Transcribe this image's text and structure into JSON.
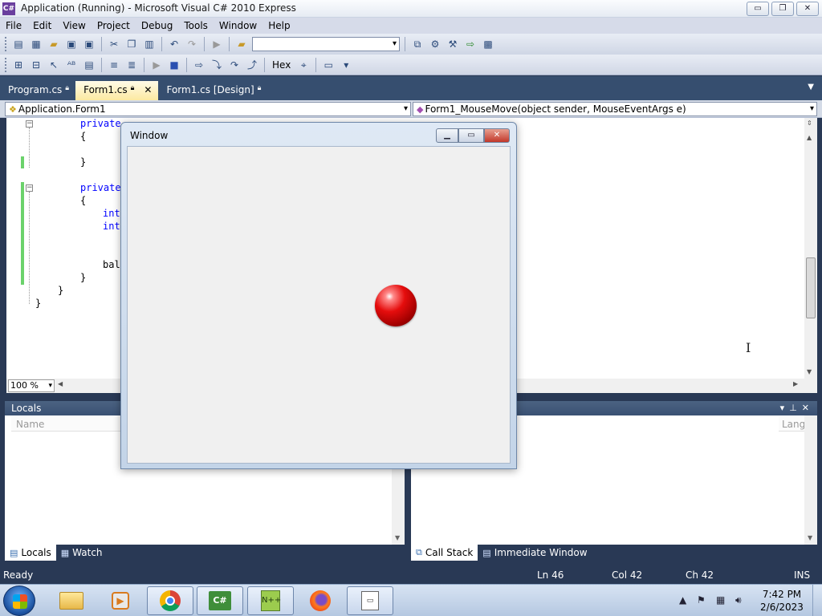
{
  "vs": {
    "title": "Application (Running) - Microsoft Visual C# 2010 Express",
    "app_icon_text": "C#",
    "window_buttons": {
      "minimize": "▭",
      "restore": "❐",
      "close": "✕"
    }
  },
  "menu": [
    "File",
    "Edit",
    "View",
    "Project",
    "Debug",
    "Tools",
    "Window",
    "Help"
  ],
  "toolbar2": {
    "hex_label": "Hex"
  },
  "doc_tabs": [
    {
      "label": "Program.cs",
      "locked": true,
      "active": false
    },
    {
      "label": "Form1.cs",
      "locked": true,
      "active": true
    },
    {
      "label": "Form1.cs [Design]",
      "locked": true,
      "active": false
    }
  ],
  "nav": {
    "class_combo": "Application.Form1",
    "member_combo": "Form1_MouseMove(object sender, MouseEventArgs e)"
  },
  "code": {
    "line1_kw": "private",
    "line2": "{",
    "line3": "}",
    "line4_kw": "private",
    "line5": "{",
    "line6_kw": "int",
    "line7_kw": "int",
    "line8": "bal",
    "line9": "}",
    "line10": "}",
    "line11": "}"
  },
  "zoom": "100 %",
  "locals": {
    "title": "Locals",
    "col_name": "Name"
  },
  "callstack": {
    "col_lang": "Lang"
  },
  "bottom_tabs_left": [
    {
      "label": "Locals",
      "active": true
    },
    {
      "label": "Watch",
      "active": false
    }
  ],
  "bottom_tabs_right": [
    {
      "label": "Call Stack",
      "active": true
    },
    {
      "label": "Immediate Window",
      "active": false
    }
  ],
  "status": {
    "ready": "Ready",
    "ln": "Ln 46",
    "col": "Col 42",
    "ch": "Ch 42",
    "mode": "INS"
  },
  "app_window": {
    "title": "Window"
  },
  "taskbar": {
    "time": "7:42 PM",
    "date": "2/6/2023"
  },
  "colors": {
    "ball": "#e50d0d",
    "accent": "#293955",
    "active_tab": "#fce9a0"
  }
}
